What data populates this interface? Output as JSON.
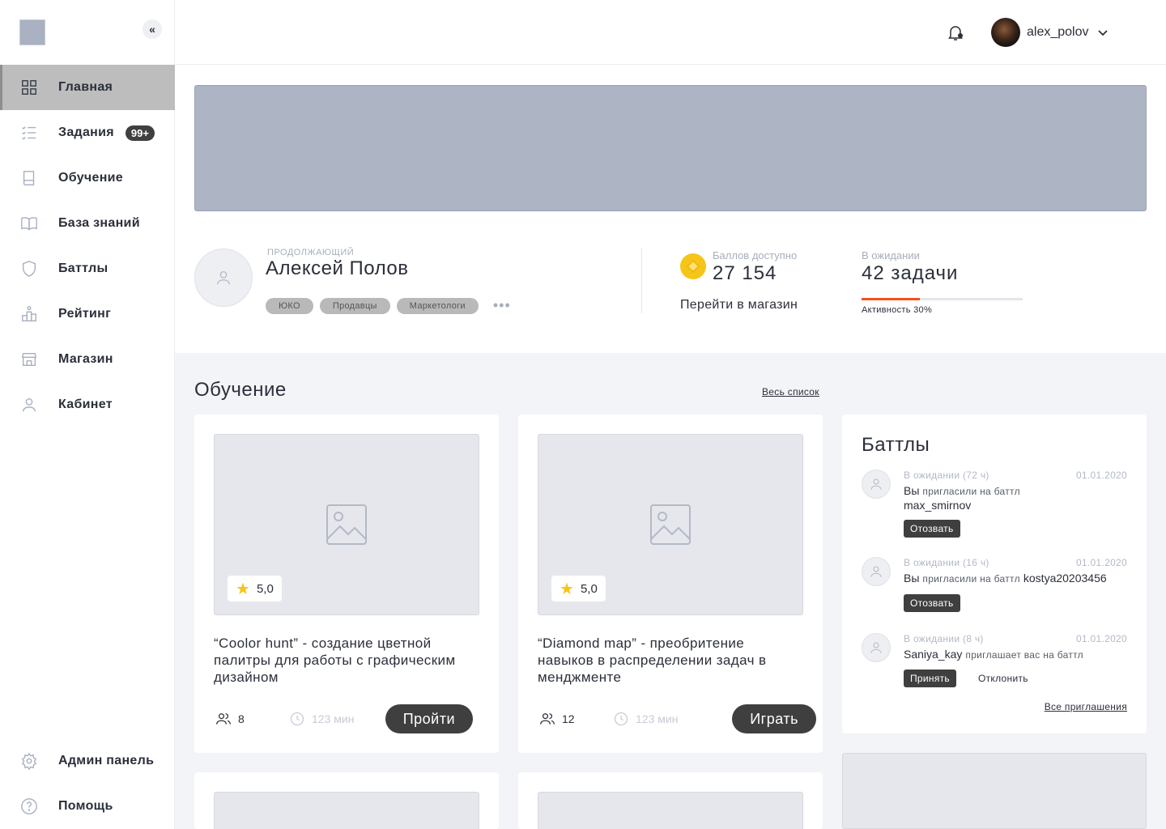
{
  "sidebar": {
    "collapse_label": "«",
    "items": [
      {
        "label": "Главная",
        "icon": "grid-icon",
        "active": true
      },
      {
        "label": "Задания",
        "icon": "checklist-icon",
        "badge": "99+"
      },
      {
        "label": "Обучение",
        "icon": "book-icon"
      },
      {
        "label": "База знаний",
        "icon": "open-book-icon"
      },
      {
        "label": "Баттлы",
        "icon": "shield-icon"
      },
      {
        "label": "Рейтинг",
        "icon": "podium-icon"
      },
      {
        "label": "Магазин",
        "icon": "store-icon"
      },
      {
        "label": "Кабинет",
        "icon": "user-icon"
      }
    ],
    "bottom_items": [
      {
        "label": "Админ панель",
        "icon": "gear-icon"
      },
      {
        "label": "Помощь",
        "icon": "help-icon"
      }
    ]
  },
  "header": {
    "username": "alex_polov"
  },
  "profile": {
    "role": "ПРОДОЛЖАЮЩИЙ",
    "name": "Алексей Полов",
    "tags": [
      "ЮКО",
      "Продавцы",
      "Маркетологи"
    ],
    "tags_more": "•••",
    "points_label": "Баллов доступно",
    "points_value": "27 154",
    "shop_link": "Перейти в магазин",
    "pending_label": "В ожидании",
    "pending_value": "42 задачи",
    "activity_label": "Активность 30%",
    "activity_fraction": 0.36
  },
  "learning": {
    "title": "Обучение",
    "all_link": "Весь список",
    "cards": [
      {
        "rating": "5,0",
        "title": "“Coolor hunt” - создание цветной палитры для работы с графическим дизайном",
        "users": "8",
        "time": "123 мин",
        "button": "Пройти"
      },
      {
        "rating": "5,0",
        "title": "“Diamond map” - преобритение навыков в распределении задач в менджменте",
        "users": "12",
        "time": "123 мин",
        "button": "Играть"
      }
    ]
  },
  "battles": {
    "title": "Баттлы",
    "invitations": [
      {
        "status": "В ожидании (72 ч)",
        "date": "01.01.2020",
        "who": "Вы",
        "action": "пригласили на баттл",
        "target": "max_smirnov",
        "primary": "Отозвать"
      },
      {
        "status": "В ожидании (16 ч)",
        "date": "01.01.2020",
        "who": "Вы",
        "action": "пригласили на баттл",
        "target": "kostya20203456",
        "primary": "Отозвать"
      },
      {
        "status": "В ожидании (8 ч)",
        "date": "01.01.2020",
        "who": "Saniya_kay",
        "action": "приглашает вас на баттл",
        "target": "",
        "primary": "Принять",
        "secondary": "Отклонить"
      }
    ],
    "all_link": "Все приглашения"
  },
  "colors": {
    "accent_dark": "#3f3f3f",
    "activity": "#f4511e",
    "coin": "#f5c518",
    "banner": "#adb5c5"
  }
}
